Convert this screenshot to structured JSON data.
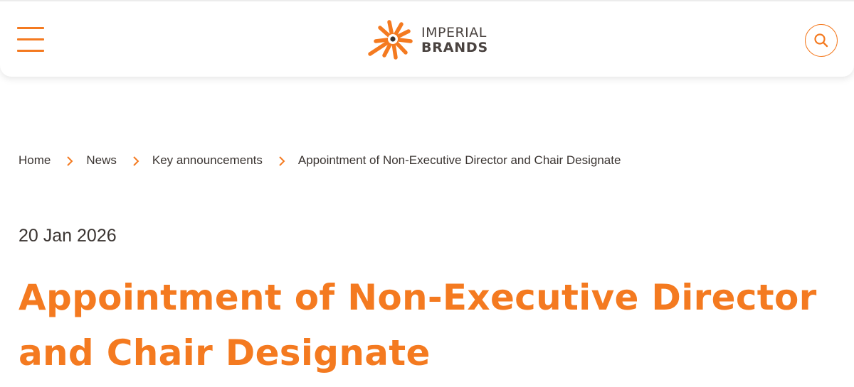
{
  "header": {
    "logo": {
      "line1": "IMPERIAL",
      "line2": "BRANDS"
    },
    "menu_icon": "hamburger-menu-icon",
    "search_icon": "search-icon"
  },
  "breadcrumb": {
    "items": [
      {
        "label": "Home"
      },
      {
        "label": "News"
      },
      {
        "label": "Key announcements"
      },
      {
        "label": "Appointment of Non-Executive Director and Chair Designate"
      }
    ],
    "separator_icon": "chevron-right-icon"
  },
  "article": {
    "date": "20 Jan 2026",
    "title": "Appointment of Non-Executive Director and Chair Designate"
  },
  "colors": {
    "accent": "#f47a20",
    "text": "#3a3431"
  }
}
